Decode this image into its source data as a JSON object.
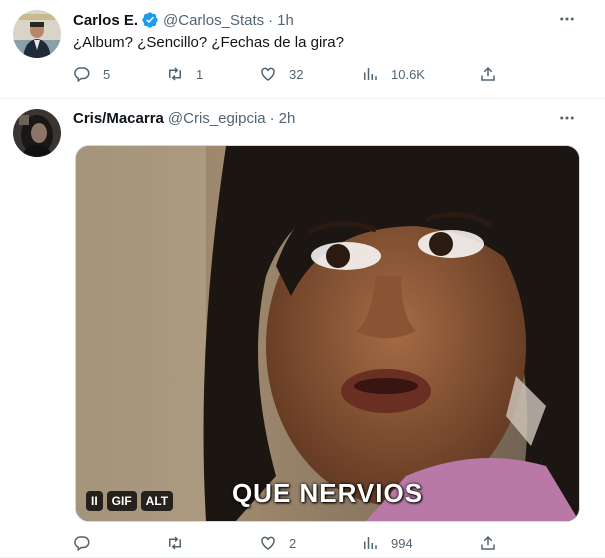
{
  "tweets": [
    {
      "name": "Carlos E.",
      "handle": "@Carlos_Stats",
      "separator": "·",
      "time": "1h",
      "verified": true,
      "text": "¿Album? ¿Sencillo? ¿Fechas de la gira?",
      "replies": "5",
      "retweets": "1",
      "likes": "32",
      "views": "10.6K"
    },
    {
      "name": "Cris/Macarra",
      "handle": "@Cris_egipcia",
      "separator": "·",
      "time": "2h",
      "verified": false,
      "media": {
        "caption": "QUE NERVIOS",
        "pause_label": "II",
        "gif_label": "GIF",
        "alt_label": "ALT"
      },
      "replies": "",
      "retweets": "",
      "likes": "2",
      "views": "994"
    }
  ],
  "icons": [
    "more-icon",
    "reply-icon",
    "retweet-icon",
    "like-icon",
    "views-icon",
    "share-icon",
    "verified-icon"
  ],
  "colors": {
    "text": "#0f1419",
    "muted": "#536471",
    "verified": "#1d9bf0",
    "divider": "#eff3f4"
  }
}
